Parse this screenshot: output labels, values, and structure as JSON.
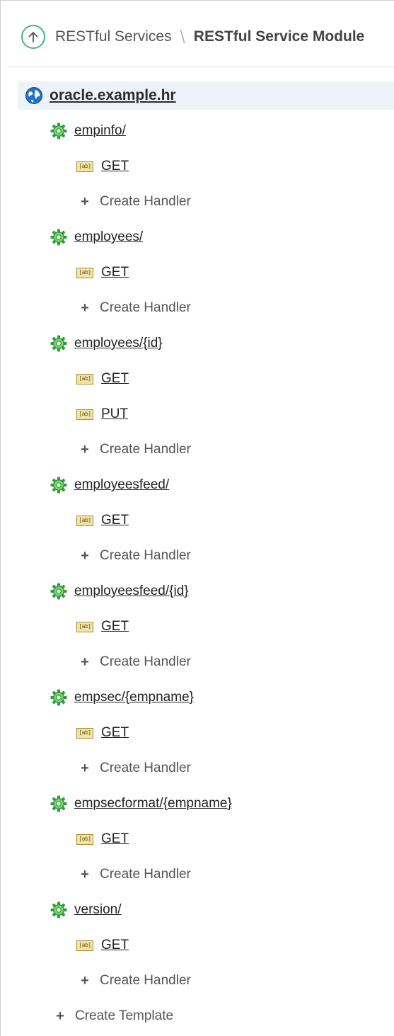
{
  "breadcrumb": {
    "parent": "RESTful Services",
    "separator": "\\",
    "current": "RESTful Service Module"
  },
  "module": {
    "name": "oracle.example.hr"
  },
  "templates": [
    {
      "name": "empinfo/",
      "handlers": [
        "GET"
      ]
    },
    {
      "name": "employees/",
      "handlers": [
        "GET"
      ]
    },
    {
      "name": "employees/{id}",
      "handlers": [
        "GET",
        "PUT"
      ]
    },
    {
      "name": "employeesfeed/",
      "handlers": [
        "GET"
      ]
    },
    {
      "name": "employeesfeed/{id}",
      "handlers": [
        "GET"
      ]
    },
    {
      "name": "empsec/{empname}",
      "handlers": [
        "GET"
      ]
    },
    {
      "name": "empsecformat/{empname}",
      "handlers": [
        "GET"
      ]
    },
    {
      "name": "version/",
      "handlers": [
        "GET"
      ]
    }
  ],
  "actions": {
    "create_handler": "Create Handler",
    "create_template": "Create Template"
  },
  "icons": {
    "up": "arrow-up-circle-icon",
    "module": "globe-icon",
    "template": "gear-icon",
    "handler": "abl-source-icon",
    "add": "plus-icon"
  },
  "colors": {
    "accent_green": "#41b883",
    "gear_green": "#2f9a3e",
    "globe_blue": "#1f74c9",
    "selected_bg": "#eef3f9",
    "handler_icon_fill": "#f1e4a8"
  }
}
